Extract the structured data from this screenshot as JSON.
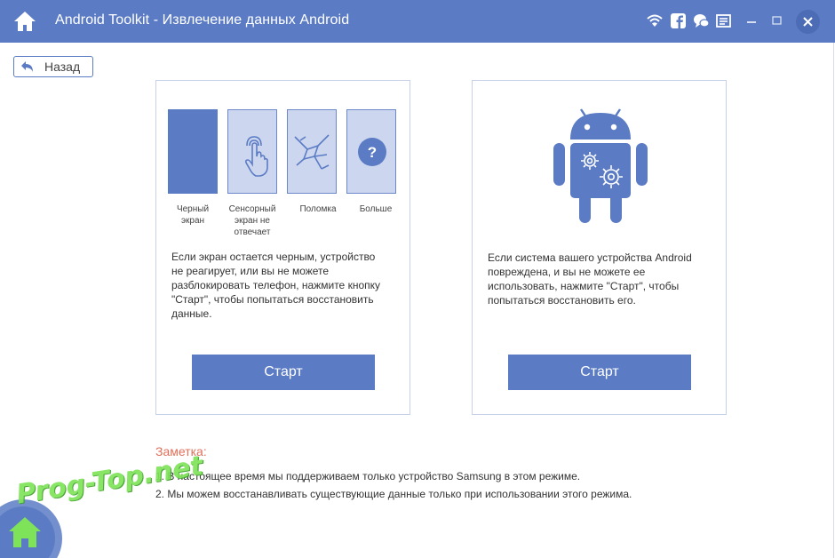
{
  "window": {
    "title": "Android Toolkit - Извлечение данных Android",
    "icons": [
      "home-icon",
      "wifi-icon",
      "facebook-icon",
      "chat-icon",
      "feedback-icon",
      "minimize-icon",
      "close-icon"
    ]
  },
  "back_button": {
    "label": "Назад"
  },
  "left_panel": {
    "tiles": [
      {
        "icon": "black-screen",
        "label": "Черный\nэкран"
      },
      {
        "icon": "touch-icon",
        "label": "Сенсорный\nэкран не\nотвечает"
      },
      {
        "icon": "broken-screen-icon",
        "label": "Поломка"
      },
      {
        "icon": "question-icon",
        "label": "Больше"
      }
    ],
    "description": "Если экран остается черным, устройство\nне реагирует, или вы не можете\nразблокировать телефон, нажмите кнопку\n\"Старт\", чтобы попытаться восстановить\nданные.",
    "button_label": "Старт"
  },
  "right_panel": {
    "image": "android-robot-gears-icon",
    "description": "Если система вашего устройства Android\nповреждена, и вы не можете ее\nиспользовать, нажмите \"Старт\", чтобы\nпопытаться восстановить его.",
    "button_label": "Старт"
  },
  "note": {
    "title": "Заметка:",
    "lines": [
      "1. В настоящее время мы поддерживаем только устройство Samsung в этом режиме.",
      "2. Мы можем восстанавливать существующие данные только при использовании этого режима."
    ]
  },
  "watermark": {
    "text": "Prog-Top.net"
  },
  "colors": {
    "accent": "#5b7bc4",
    "tile_light": "#ccd7ef",
    "note_title": "#e0705a",
    "watermark": "#7fe35a"
  }
}
